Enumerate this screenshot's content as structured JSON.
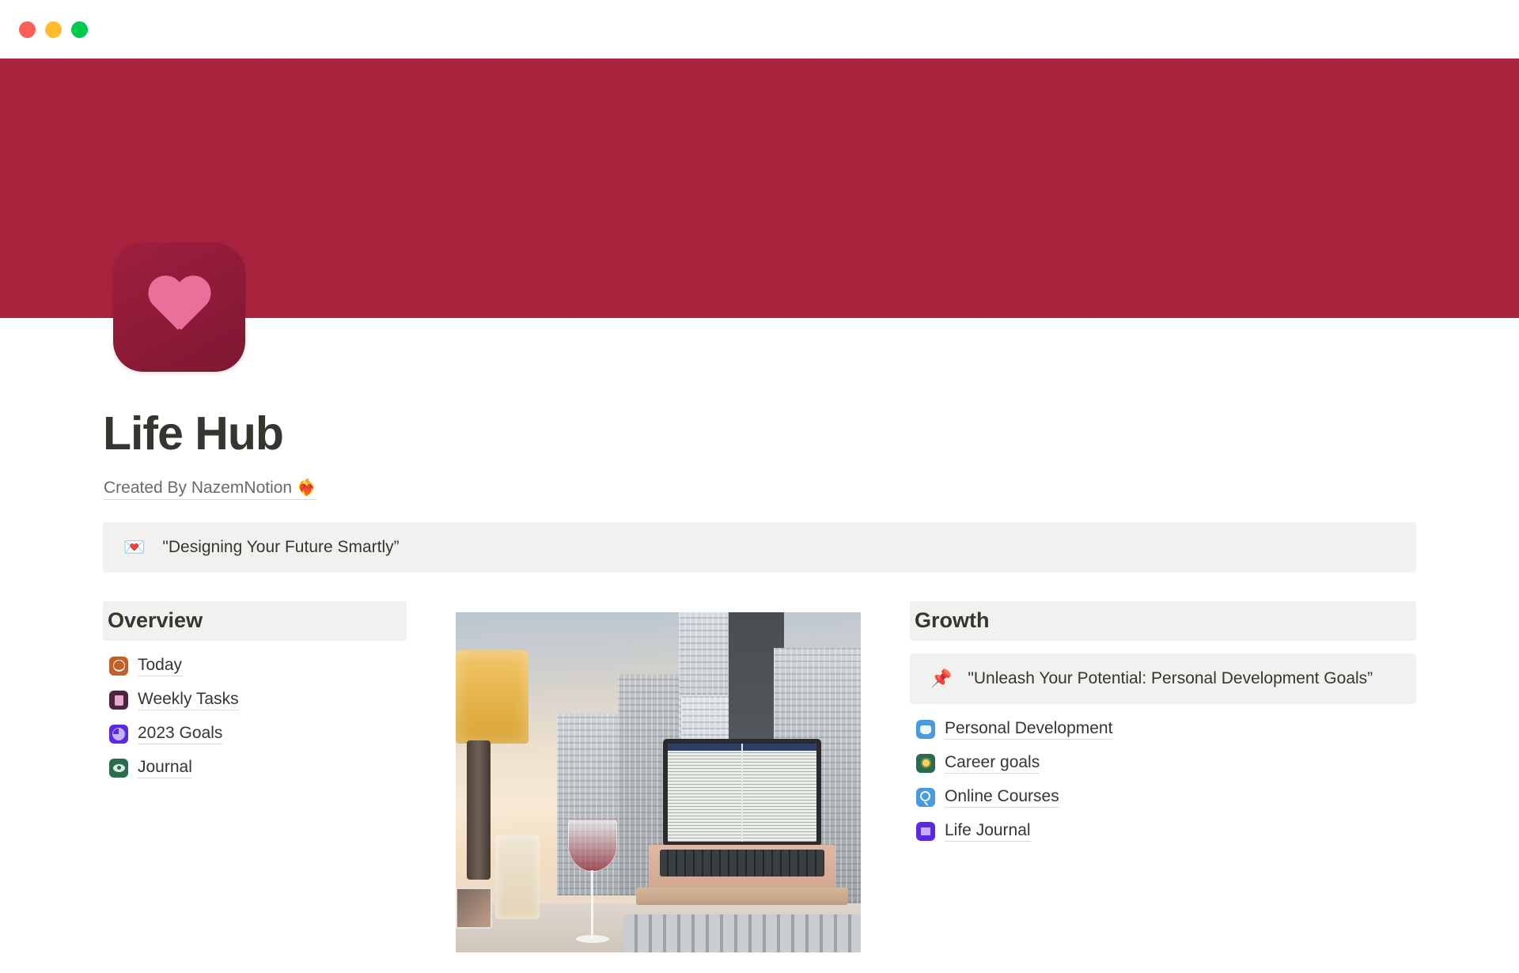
{
  "window": {
    "controls": [
      {
        "name": "close",
        "color": "#ff5f57"
      },
      {
        "name": "minimize",
        "color": "#ffbd2e"
      },
      {
        "name": "maximize",
        "color": "#00ca4e"
      }
    ]
  },
  "cover": {
    "color": "#a9233f"
  },
  "page_icon": {
    "emoji": "heart",
    "background": "#8d1a38",
    "heart_color": "#e8709b"
  },
  "page": {
    "title": "Life Hub",
    "byline": "Created By NazemNotion",
    "byline_emoji": "❤️‍🔥"
  },
  "quote_callout": {
    "emoji": "💌",
    "text": "\"Designing Your Future Smartly”",
    "background": "#f1f1ef"
  },
  "overview": {
    "heading": "Overview",
    "items": [
      {
        "label": "Today",
        "icon": "clock-icon",
        "icon_color": "#c2622a"
      },
      {
        "label": "Weekly Tasks",
        "icon": "document-icon",
        "icon_color": "#4d2341"
      },
      {
        "label": "2023 Goals",
        "icon": "pie-chart-icon",
        "icon_color": "#5b2ae0"
      },
      {
        "label": "Journal",
        "icon": "eye-icon",
        "icon_color": "#2d6b4f"
      }
    ]
  },
  "photo": {
    "alt": "Desk by window at sunset with lamp, candle, wine glass, laptop on stand and keyboard, city skyline"
  },
  "growth": {
    "heading": "Growth",
    "callout": {
      "emoji": "📌",
      "text": "\"Unleash Your Potential: Personal Development Goals”",
      "background": "#f1f1ef"
    },
    "items": [
      {
        "label": "Personal Development",
        "icon": "chat-icon",
        "icon_color": "#4a9ae0"
      },
      {
        "label": "Career goals",
        "icon": "lightbulb-icon",
        "icon_color": "#2d6b4f"
      },
      {
        "label": "Online Courses",
        "icon": "search-icon",
        "icon_color": "#4a9ae0"
      },
      {
        "label": "Life Journal",
        "icon": "book-icon",
        "icon_color": "#5b2ae0"
      }
    ]
  }
}
